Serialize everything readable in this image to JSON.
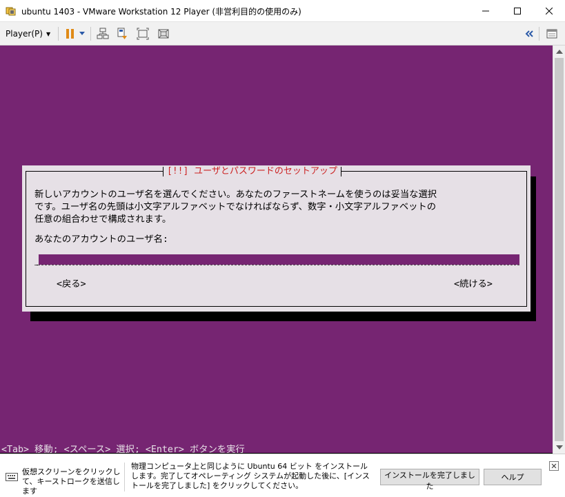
{
  "window": {
    "title": "ubuntu 1403 - VMware Workstation 12 Player (非営利目的の使用のみ)",
    "icon": "vmware-player-icon",
    "controls": [
      "minimize-icon",
      "maximize-icon",
      "close-icon"
    ]
  },
  "toolbar": {
    "player_menu": "Player(P)",
    "icons": [
      "pause-icon",
      "dropdown-caret-icon",
      "network-devices-icon",
      "send-ctrl-alt-del-icon",
      "fit-guest-icon",
      "unity-icon",
      "collapse-icon",
      "library-icon"
    ]
  },
  "installer": {
    "dialog_title": "[!!] ユーザとパスワードのセットアップ",
    "description": "新しいアカウントのユーザ名を選んでください。あなたのファーストネームを使うのは妥当な選択\nです。ユーザ名の先頭は小文字アルファベットでなければならず、数字・小文字アルファベットの\n任意の組合わせで構成されます。",
    "username_label": "あなたのアカウントのユーザ名:",
    "username_value": "",
    "back_button": "<戻る>",
    "continue_button": "<続ける>",
    "help_line": "<Tab> 移動; <スペース> 選択; <Enter> ボタンを実行",
    "colors": {
      "background": "#762572",
      "dialog": "#e6e0e6",
      "title": "#cc2020"
    }
  },
  "notification": {
    "left_text": "仮想スクリーンをクリックして、キーストロークを送信します",
    "main_text": "物理コンピュータ上と同じように Ubuntu 64 ビット をインストールします。完了してオペレーティング システムが起動した後に、[インストールを完了しました] をクリックしてください。",
    "finish_button": "インストールを完了しました",
    "help_button": "ヘルプ",
    "dismiss": "✕"
  }
}
